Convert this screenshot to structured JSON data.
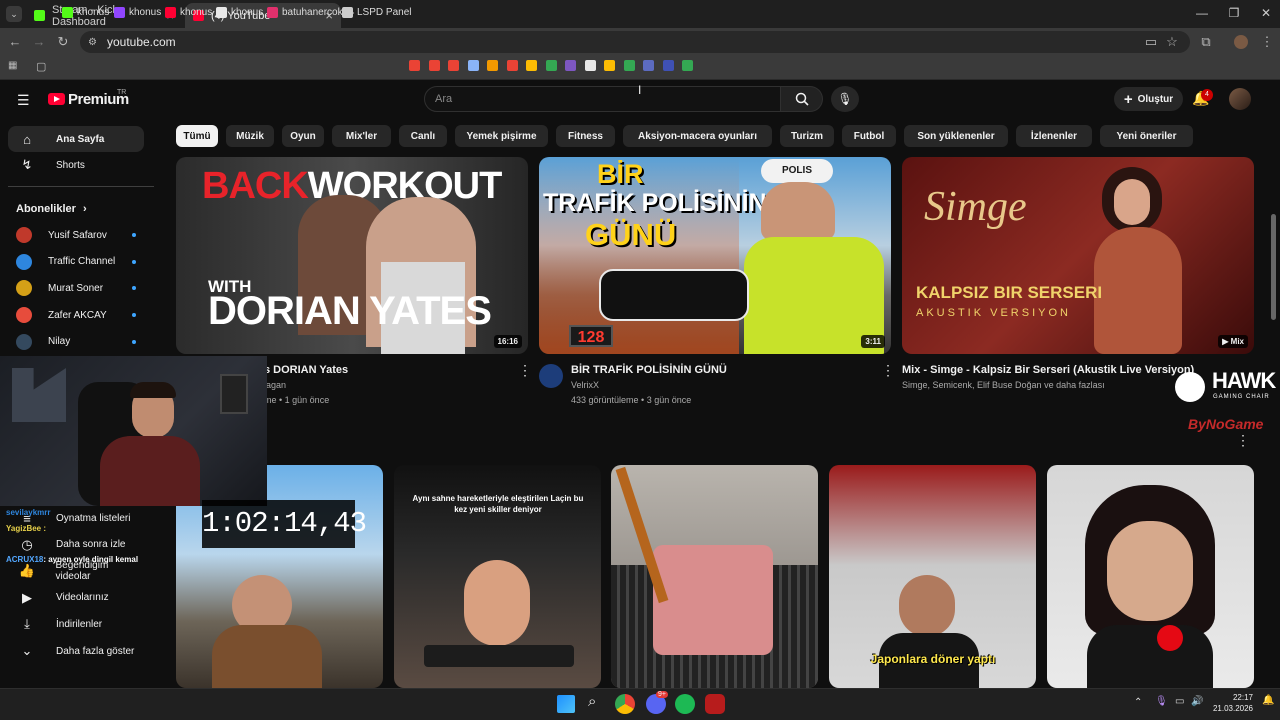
{
  "browser": {
    "tabs": [
      {
        "title": "Stream - Kick Dashboard",
        "favicon_color": "#53fc18",
        "favicon_letter": "K"
      },
      {
        "title": "(4) YouTube",
        "favicon_color": "#ff0033",
        "favicon_letter": ""
      }
    ],
    "new_tab": "+",
    "url": "youtube.com",
    "bookmarks": [
      {
        "label": "khonus",
        "color": "#53fc18"
      },
      {
        "label": "khonus",
        "color": "#9146ff"
      },
      {
        "label": "khonus",
        "color": "#ff0033"
      },
      {
        "label": "khonus",
        "color": "#e8e8e8"
      },
      {
        "label": "batuhanercok",
        "color": "#e1306c"
      },
      {
        "label": "LSPD Panel",
        "color": "#cccccc"
      }
    ],
    "bookmark_icon_colors": [
      "#ea4335",
      "#ea4335",
      "#ea4335",
      "#8ab4f8",
      "#f29900",
      "#ea4335",
      "#fbbc04",
      "#34a853",
      "#7e57c2",
      "#e8e8e8",
      "#fbbc04",
      "#34a853",
      "#5c6bc0",
      "#3f51b5",
      "#34a853"
    ]
  },
  "yt": {
    "logo": "Premium",
    "logo_sup": "TR",
    "search_placeholder": "Ara",
    "create_label": "Oluştur",
    "notifications": "4",
    "chips": [
      "Tümü",
      "Müzik",
      "Oyun",
      "Mix'ler",
      "Canlı",
      "Yemek pişirme",
      "Fitness",
      "Aksiyon-macera oyunları",
      "Turizm",
      "Futbol",
      "Son yüklenenler",
      "İzlenenler",
      "Yeni öneriler"
    ],
    "sidebar": {
      "home": "Ana Sayfa",
      "shorts": "Shorts",
      "subs_title": "Abonelikler",
      "subs": [
        {
          "name": "Yusif Safarov",
          "color": "#c0392b"
        },
        {
          "name": "Traffic Channel",
          "color": "#2e86de"
        },
        {
          "name": "Murat Soner",
          "color": "#d4a017"
        },
        {
          "name": "Zafer AKCAY",
          "color": "#e74c3c"
        },
        {
          "name": "Nilay",
          "color": "#34495e"
        }
      ],
      "you_items": [
        "Oynatma listeleri",
        "Daha sonra izle",
        "Beğendiğim videolar",
        "Videolarınız",
        "İndirilenler",
        "Daha fazla göster"
      ]
    },
    "videos": [
      {
        "thumb_title_1": "BACK",
        "thumb_title_2": "WORKOUT",
        "thumb_sub_1": "WITH",
        "thumb_sub_2": "DORIAN YATES",
        "duration": "16:16",
        "title": "s DORIAN Yates",
        "channel": "agan",
        "meta": "me • 1 gün önce"
      },
      {
        "thumb_title_1": "BİR",
        "thumb_title_2": "TRAFİK POLİSİNİN",
        "thumb_title_3": "GÜNÜ",
        "thumb_badge": "POLIS",
        "thumb_speed": "128",
        "duration": "3:11",
        "title": "BİR TRAFİK POLİSİNİN GÜNÜ",
        "channel": "VelrixX",
        "meta": "433 görüntüleme • 3 gün önce"
      },
      {
        "thumb_script": "Simge",
        "thumb_title_1": "KALPSIZ BIR SERSERI",
        "thumb_title_2": "AKUSTIK VERSIYON",
        "duration": "Mix",
        "title": "Mix - Simge - Kalpsiz Bir Serseri (Akustik Live Versiyon)",
        "channel": "Simge, Semicenk, Elif Buse Doğan ve daha fazlası"
      }
    ],
    "shorts": [
      {
        "caption": ""
      },
      {
        "caption": "Aynı sahne hareketleriyle eleştirilen Laçin bu kez yeni skiller deniyor"
      },
      {
        "caption": ""
      },
      {
        "caption": "Japonlara döner yaptı"
      },
      {
        "caption": ""
      }
    ]
  },
  "overlay": {
    "timer": "1:02:14,43",
    "sponsor_1": "HAWK",
    "sponsor_2": "GAMING CHAIR",
    "sponsor_3": "ByNoGame",
    "chat": [
      {
        "user": "sevilaykmrr",
        "text": ""
      },
      {
        "user": "YagizBee",
        "text": ":"
      },
      {
        "user": "ACRUX18",
        "text": ": aynen oyle dingil kemal"
      }
    ]
  },
  "taskbar": {
    "time": "22:17",
    "date": "21.03.2026",
    "discord_badge": "9+"
  }
}
